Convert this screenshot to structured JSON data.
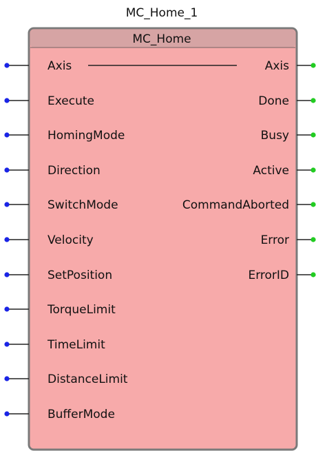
{
  "instance_name": "MC_Home_1",
  "block_type": "MC_Home",
  "colors": {
    "block_fill": "#f7aaaa",
    "header_fill": "#d6a4a4",
    "border": "#7a7a7a",
    "input_dot": "#1a24e6",
    "output_dot": "#22cc22"
  },
  "inputs": [
    {
      "label": "Axis"
    },
    {
      "label": "Execute"
    },
    {
      "label": "HomingMode"
    },
    {
      "label": "Direction"
    },
    {
      "label": "SwitchMode"
    },
    {
      "label": "Velocity"
    },
    {
      "label": "SetPosition"
    },
    {
      "label": "TorqueLimit"
    },
    {
      "label": "TimeLimit"
    },
    {
      "label": "DistanceLimit"
    },
    {
      "label": "BufferMode"
    }
  ],
  "outputs": [
    {
      "label": "Axis"
    },
    {
      "label": "Done"
    },
    {
      "label": "Busy"
    },
    {
      "label": "Active"
    },
    {
      "label": "CommandAborted"
    },
    {
      "label": "Error"
    },
    {
      "label": "ErrorID"
    }
  ]
}
